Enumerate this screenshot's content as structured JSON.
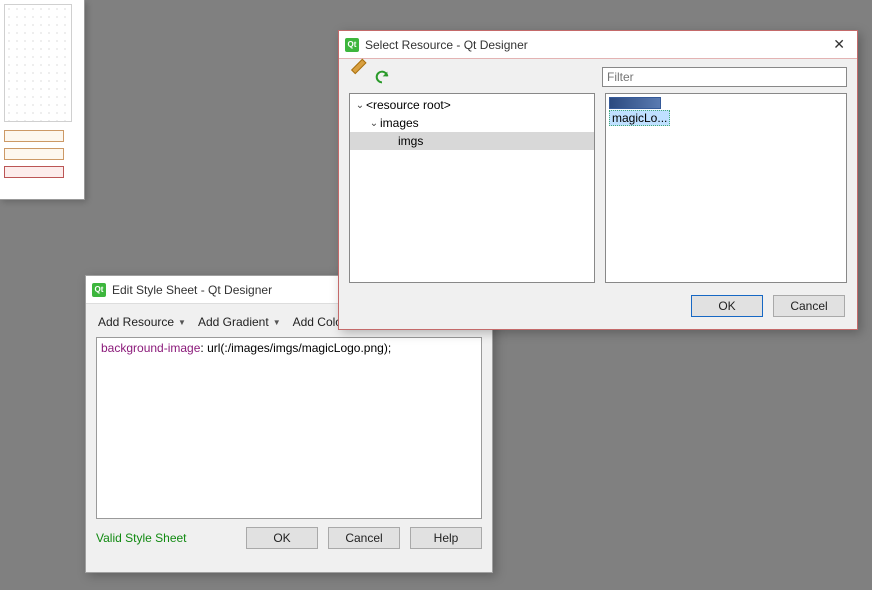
{
  "designer_stub": {},
  "stylesheet_window": {
    "title": "Edit Style Sheet - Qt Designer",
    "menu": {
      "add_resource": "Add Resource",
      "add_gradient": "Add Gradient",
      "add_color": "Add Colo"
    },
    "css": {
      "property": "background-image",
      "value": ": url(:/images/imgs/magicLogo.png);"
    },
    "status": "Valid Style Sheet",
    "buttons": {
      "ok": "OK",
      "cancel": "Cancel",
      "help": "Help"
    }
  },
  "resource_window": {
    "title": "Select Resource - Qt Designer",
    "filter_placeholder": "Filter",
    "tree": {
      "root": "<resource root>",
      "level1": "images",
      "level2": "imgs"
    },
    "thumbnails": [
      {
        "name": "magicLo...",
        "selected": true
      }
    ],
    "buttons": {
      "ok": "OK",
      "cancel": "Cancel"
    }
  }
}
